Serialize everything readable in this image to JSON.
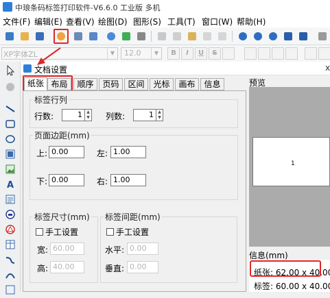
{
  "app": {
    "title": "中琅条码标签打印软件-V6.6.0 工业版 多机"
  },
  "menu": [
    {
      "label": "文件(F)"
    },
    {
      "label": "编辑(E)"
    },
    {
      "label": "查看(V)"
    },
    {
      "label": "绘图(D)"
    },
    {
      "label": "图形(S)"
    },
    {
      "label": "工具(T)"
    },
    {
      "label": "窗口(W)"
    },
    {
      "label": "帮助(H)"
    }
  ],
  "font_toolbar": {
    "font_name": "XP字体ZL",
    "font_size": "12.0",
    "bold": "B",
    "italic": "I",
    "underline": "U",
    "strike": "S"
  },
  "dialog": {
    "title": "文档设置",
    "close": "x",
    "tabs": [
      "纸张",
      "布局",
      "顺序",
      "页码",
      "区间",
      "光标",
      "画布",
      "信息"
    ],
    "label_rows_cols": {
      "title": "标签行列",
      "rows_label": "行数:",
      "rows_value": "1",
      "cols_label": "列数:",
      "cols_value": "1"
    },
    "page_margin": {
      "title": "页面边距(mm)",
      "top_label": "上:",
      "top_value": "0.00",
      "left_label": "左:",
      "left_value": "1.00",
      "bottom_label": "下:",
      "bottom_value": "0.00",
      "right_label": "右:",
      "right_value": "1.00"
    },
    "label_size": {
      "title": "标签尺寸(mm)",
      "manual_label": "手工设置",
      "width_label": "宽:",
      "width_value": "60.00",
      "height_label": "高:",
      "height_value": "40.00"
    },
    "label_spacing": {
      "title": "标签间距(mm)",
      "manual_label": "手工设置",
      "h_label": "水平:",
      "h_value": "0.00",
      "v_label": "垂直:",
      "v_value": "0.00"
    },
    "preview": {
      "title": "预览",
      "label_number": "1"
    },
    "info": {
      "title": "信息(mm)",
      "paper": "纸张: 62.00 x 40.00",
      "label": "标签: 60.00 x 40.00"
    }
  },
  "colors": {
    "highlight_red": "#e0262a",
    "accent_blue": "#2f7fd9",
    "preview_bg": "#ababab"
  }
}
